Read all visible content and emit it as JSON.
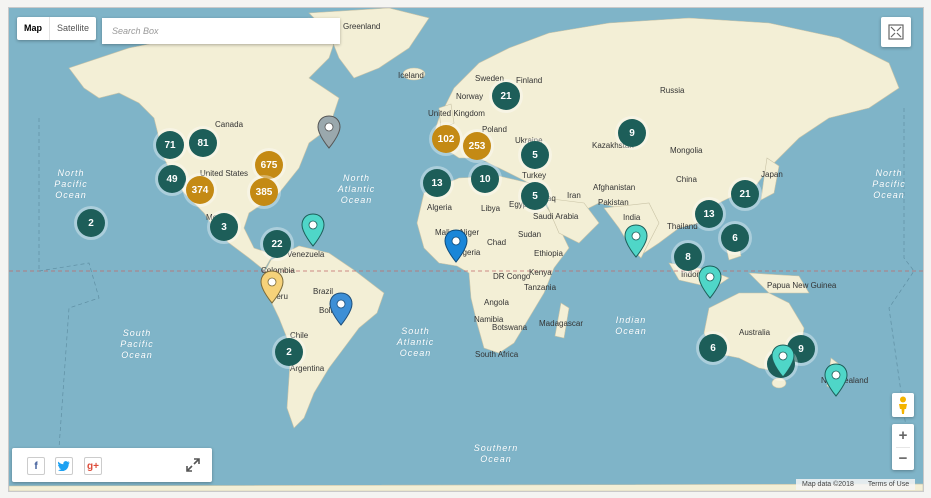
{
  "map_type": {
    "map": "Map",
    "satellite": "Satellite"
  },
  "search": {
    "placeholder": "Search Box"
  },
  "countries": [
    {
      "name": "Greenland"
    },
    {
      "name": "Iceland"
    },
    {
      "name": "Canada"
    },
    {
      "name": "United States"
    },
    {
      "name": "Mexico"
    },
    {
      "name": "Venezuela"
    },
    {
      "name": "Colombia"
    },
    {
      "name": "Peru"
    },
    {
      "name": "Brazil"
    },
    {
      "name": "Bolivia"
    },
    {
      "name": "Chile"
    },
    {
      "name": "Argentina"
    },
    {
      "name": "Sweden"
    },
    {
      "name": "Finland"
    },
    {
      "name": "Norway"
    },
    {
      "name": "United Kingdom"
    },
    {
      "name": "Poland"
    },
    {
      "name": "Ukraine"
    },
    {
      "name": "Russia"
    },
    {
      "name": "Kazakhstan"
    },
    {
      "name": "Mongolia"
    },
    {
      "name": "China"
    },
    {
      "name": "Japan"
    },
    {
      "name": "Turkey"
    },
    {
      "name": "Iran"
    },
    {
      "name": "Iraq"
    },
    {
      "name": "Afghanistan"
    },
    {
      "name": "Pakistan"
    },
    {
      "name": "India"
    },
    {
      "name": "Saudi Arabia"
    },
    {
      "name": "Egypt"
    },
    {
      "name": "Libya"
    },
    {
      "name": "Algeria"
    },
    {
      "name": "Mali"
    },
    {
      "name": "Niger"
    },
    {
      "name": "Chad"
    },
    {
      "name": "Sudan"
    },
    {
      "name": "Nigeria"
    },
    {
      "name": "Ethiopia"
    },
    {
      "name": "DR Congo"
    },
    {
      "name": "Kenya"
    },
    {
      "name": "Tanzania"
    },
    {
      "name": "Angola"
    },
    {
      "name": "Namibia"
    },
    {
      "name": "Botswana"
    },
    {
      "name": "South Africa"
    },
    {
      "name": "Madagascar"
    },
    {
      "name": "Thailand"
    },
    {
      "name": "Indonesia"
    },
    {
      "name": "Papua New Guinea"
    },
    {
      "name": "Australia"
    },
    {
      "name": "New Zealand"
    }
  ],
  "oceans": [
    {
      "name": "North Pacific Ocean"
    },
    {
      "name": "North Pacific Ocean"
    },
    {
      "name": "North Atlantic Ocean"
    },
    {
      "name": "South Pacific Ocean"
    },
    {
      "name": "South Atlantic Ocean"
    },
    {
      "name": "Indian Ocean"
    },
    {
      "name": "Southern Ocean"
    }
  ],
  "clusters": [
    {
      "count": "71",
      "color": "green"
    },
    {
      "count": "81",
      "color": "green"
    },
    {
      "count": "49",
      "color": "green"
    },
    {
      "count": "374",
      "color": "gold"
    },
    {
      "count": "675",
      "color": "gold"
    },
    {
      "count": "385",
      "color": "gold"
    },
    {
      "count": "3",
      "color": "green"
    },
    {
      "count": "2",
      "color": "green"
    },
    {
      "count": "22",
      "color": "green"
    },
    {
      "count": "2",
      "color": "green"
    },
    {
      "count": "102",
      "color": "gold"
    },
    {
      "count": "253",
      "color": "gold"
    },
    {
      "count": "21",
      "color": "green"
    },
    {
      "count": "9",
      "color": "green"
    },
    {
      "count": "5",
      "color": "green"
    },
    {
      "count": "13",
      "color": "green"
    },
    {
      "count": "10",
      "color": "green"
    },
    {
      "count": "5",
      "color": "green"
    },
    {
      "count": "21",
      "color": "green"
    },
    {
      "count": "13",
      "color": "green"
    },
    {
      "count": "6",
      "color": "green"
    },
    {
      "count": "8",
      "color": "green"
    },
    {
      "count": "6",
      "color": "green"
    },
    {
      "count": "9",
      "color": "green"
    },
    {
      "count": "8",
      "color": "green"
    }
  ],
  "pins": [
    {
      "color": "#9aa8ad"
    },
    {
      "color": "#4fd6c8"
    },
    {
      "color": "#f6d27a"
    },
    {
      "color": "#3d8fd6"
    },
    {
      "color": "#1a86d8"
    },
    {
      "color": "#4fd6c8"
    },
    {
      "color": "#4fd6c8"
    },
    {
      "color": "#4fd6c8"
    },
    {
      "color": "#4fd6c8"
    }
  ],
  "colors": {
    "water": "#7fb4c8",
    "land": "#f3efd6",
    "cluster_green": "#1d5e59",
    "cluster_gold": "#c48a14"
  },
  "icons": {
    "fullscreen": "fullscreen-icon",
    "pegman": "pegman-icon",
    "facebook": "facebook-icon",
    "twitter": "twitter-icon",
    "googleplus": "google-plus-icon",
    "expand": "expand-icon"
  },
  "zoom": {
    "in": "+",
    "out": "−"
  },
  "share": {
    "facebook": "f",
    "googleplus": "g+"
  },
  "attribution": {
    "data": "Map data ©2018",
    "terms": "Terms of Use"
  }
}
